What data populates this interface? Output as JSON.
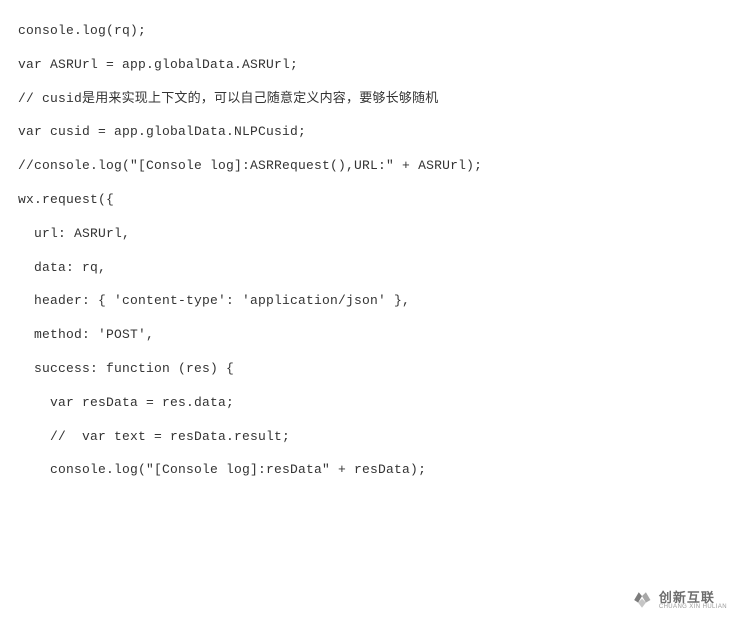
{
  "code": {
    "lines": [
      "console.log(rq);",
      "",
      "var ASRUrl = app.globalData.ASRUrl;",
      "",
      "// cusid是用来实现上下文的，可以自己随意定义内容，要够长够随机",
      "",
      "var cusid = app.globalData.NLPCusid;",
      "",
      "//console.log(\"[Console log]:ASRRequest(),URL:\" + ASRUrl);",
      "",
      "wx.request({",
      "",
      "  url: ASRUrl,",
      "",
      "  data: rq,",
      "",
      "  header: { 'content-type': 'application/json' },",
      "",
      "  method: 'POST',",
      "",
      "  success: function (res) {",
      "",
      "    var resData = res.data;",
      "",
      "    //  var text = resData.result;",
      "",
      "    console.log(\"[Console log]:resData\" + resData);"
    ]
  },
  "watermark": {
    "main": "创新互联",
    "sub": "CHUANG XIN HULIAN"
  }
}
